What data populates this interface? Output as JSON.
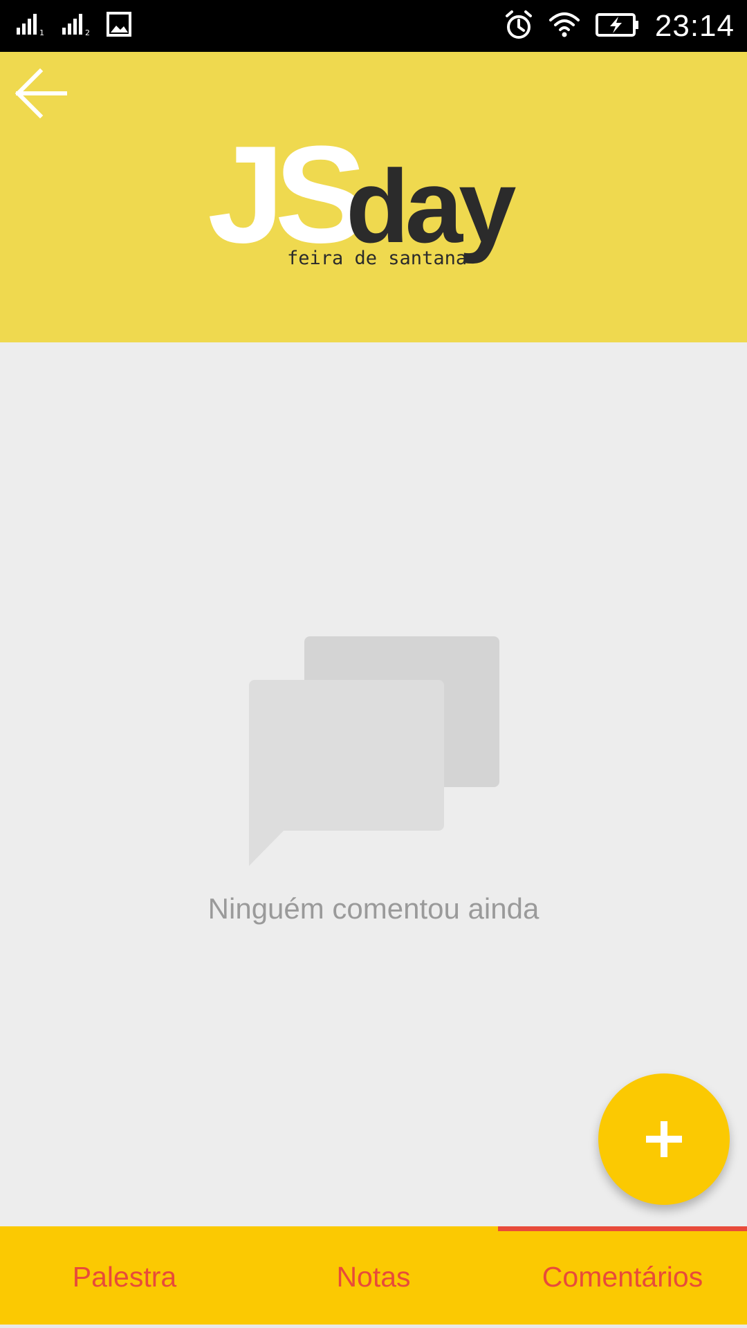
{
  "status_bar": {
    "time": "23:14",
    "icons": [
      "signal-sim1-icon",
      "signal-sim2-icon",
      "image-notification-icon",
      "alarm-icon",
      "wifi-icon",
      "battery-charging-icon"
    ]
  },
  "header": {
    "brand": {
      "js": "JS",
      "day": "day",
      "tagline": "feira de santana"
    },
    "back_icon": "arrow-left-icon",
    "background_color": "#efd94f"
  },
  "empty_state": {
    "icon": "chat-bubbles-icon",
    "message": "Ninguém comentou ainda"
  },
  "fab": {
    "icon": "plus-icon",
    "color": "#fbc902"
  },
  "tabs": {
    "active_index": 2,
    "accent_color": "#e84b3a",
    "items": [
      {
        "label": "Palestra"
      },
      {
        "label": "Notas"
      },
      {
        "label": "Comentários"
      }
    ]
  }
}
